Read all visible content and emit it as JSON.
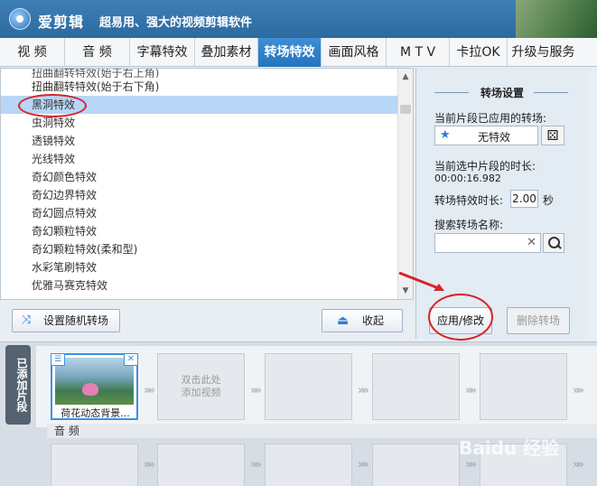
{
  "app": {
    "name": "爱剪辑",
    "slogan": "超易用、强大的视频剪辑软件"
  },
  "tabs": [
    {
      "label": "视 频",
      "active": false
    },
    {
      "label": "音 频",
      "active": false
    },
    {
      "label": "字幕特效",
      "active": false
    },
    {
      "label": "叠加素材",
      "active": false
    },
    {
      "label": "转场特效",
      "active": true
    },
    {
      "label": "画面风格",
      "active": false
    },
    {
      "label": "M T V",
      "active": false
    },
    {
      "label": "卡拉OK",
      "active": false
    },
    {
      "label": "升级与服务",
      "active": false
    }
  ],
  "effects": {
    "partial_top": "扭曲翻转特效(始于右上角)",
    "items": [
      "扭曲翻转特效(始于右下角)",
      "黑洞特效",
      "虫洞特效",
      "透镜特效",
      "光线特效",
      "奇幻颜色特效",
      "奇幻边界特效",
      "奇幻圆点特效",
      "奇幻颗粒特效",
      "奇幻颗粒特效(柔和型)",
      "水彩笔刷特效",
      "优雅马赛克特效"
    ],
    "selected_index": 1
  },
  "settings": {
    "title": "转场设置",
    "applied_label": "当前片段已应用的转场:",
    "applied_value": "无特效",
    "clip_duration_label": "当前选中片段的时长:",
    "clip_duration_value": "00:00:16.982",
    "effect_duration_label": "转场特效时长:",
    "effect_duration_value": "2.00",
    "effect_duration_unit": "秒",
    "search_label": "搜索转场名称:",
    "search_value": ""
  },
  "buttons": {
    "random": "设置随机转场",
    "collapse": "收起",
    "apply": "应用/修改",
    "delete": "删除转场"
  },
  "timeline": {
    "side_tab": "已添加片段",
    "clip_caption": "荷花动态背景...",
    "add_hint_line1": "双击此处",
    "add_hint_line2": "添加视频",
    "audio_label": "音 频"
  },
  "watermark": "Baidu 经验",
  "colors": {
    "accent": "#2f7fd0",
    "selected_row": "#b8d6f5",
    "annotation_red": "#d8232a"
  },
  "icons": {
    "logo": "app-logo-icon",
    "star": "star-icon",
    "dice": "dice-icon",
    "search": "search-icon",
    "clear": "clear-icon",
    "shuffle": "shuffle-icon",
    "collapse": "collapse-up-icon",
    "transition": "transition-arrow-icon"
  }
}
